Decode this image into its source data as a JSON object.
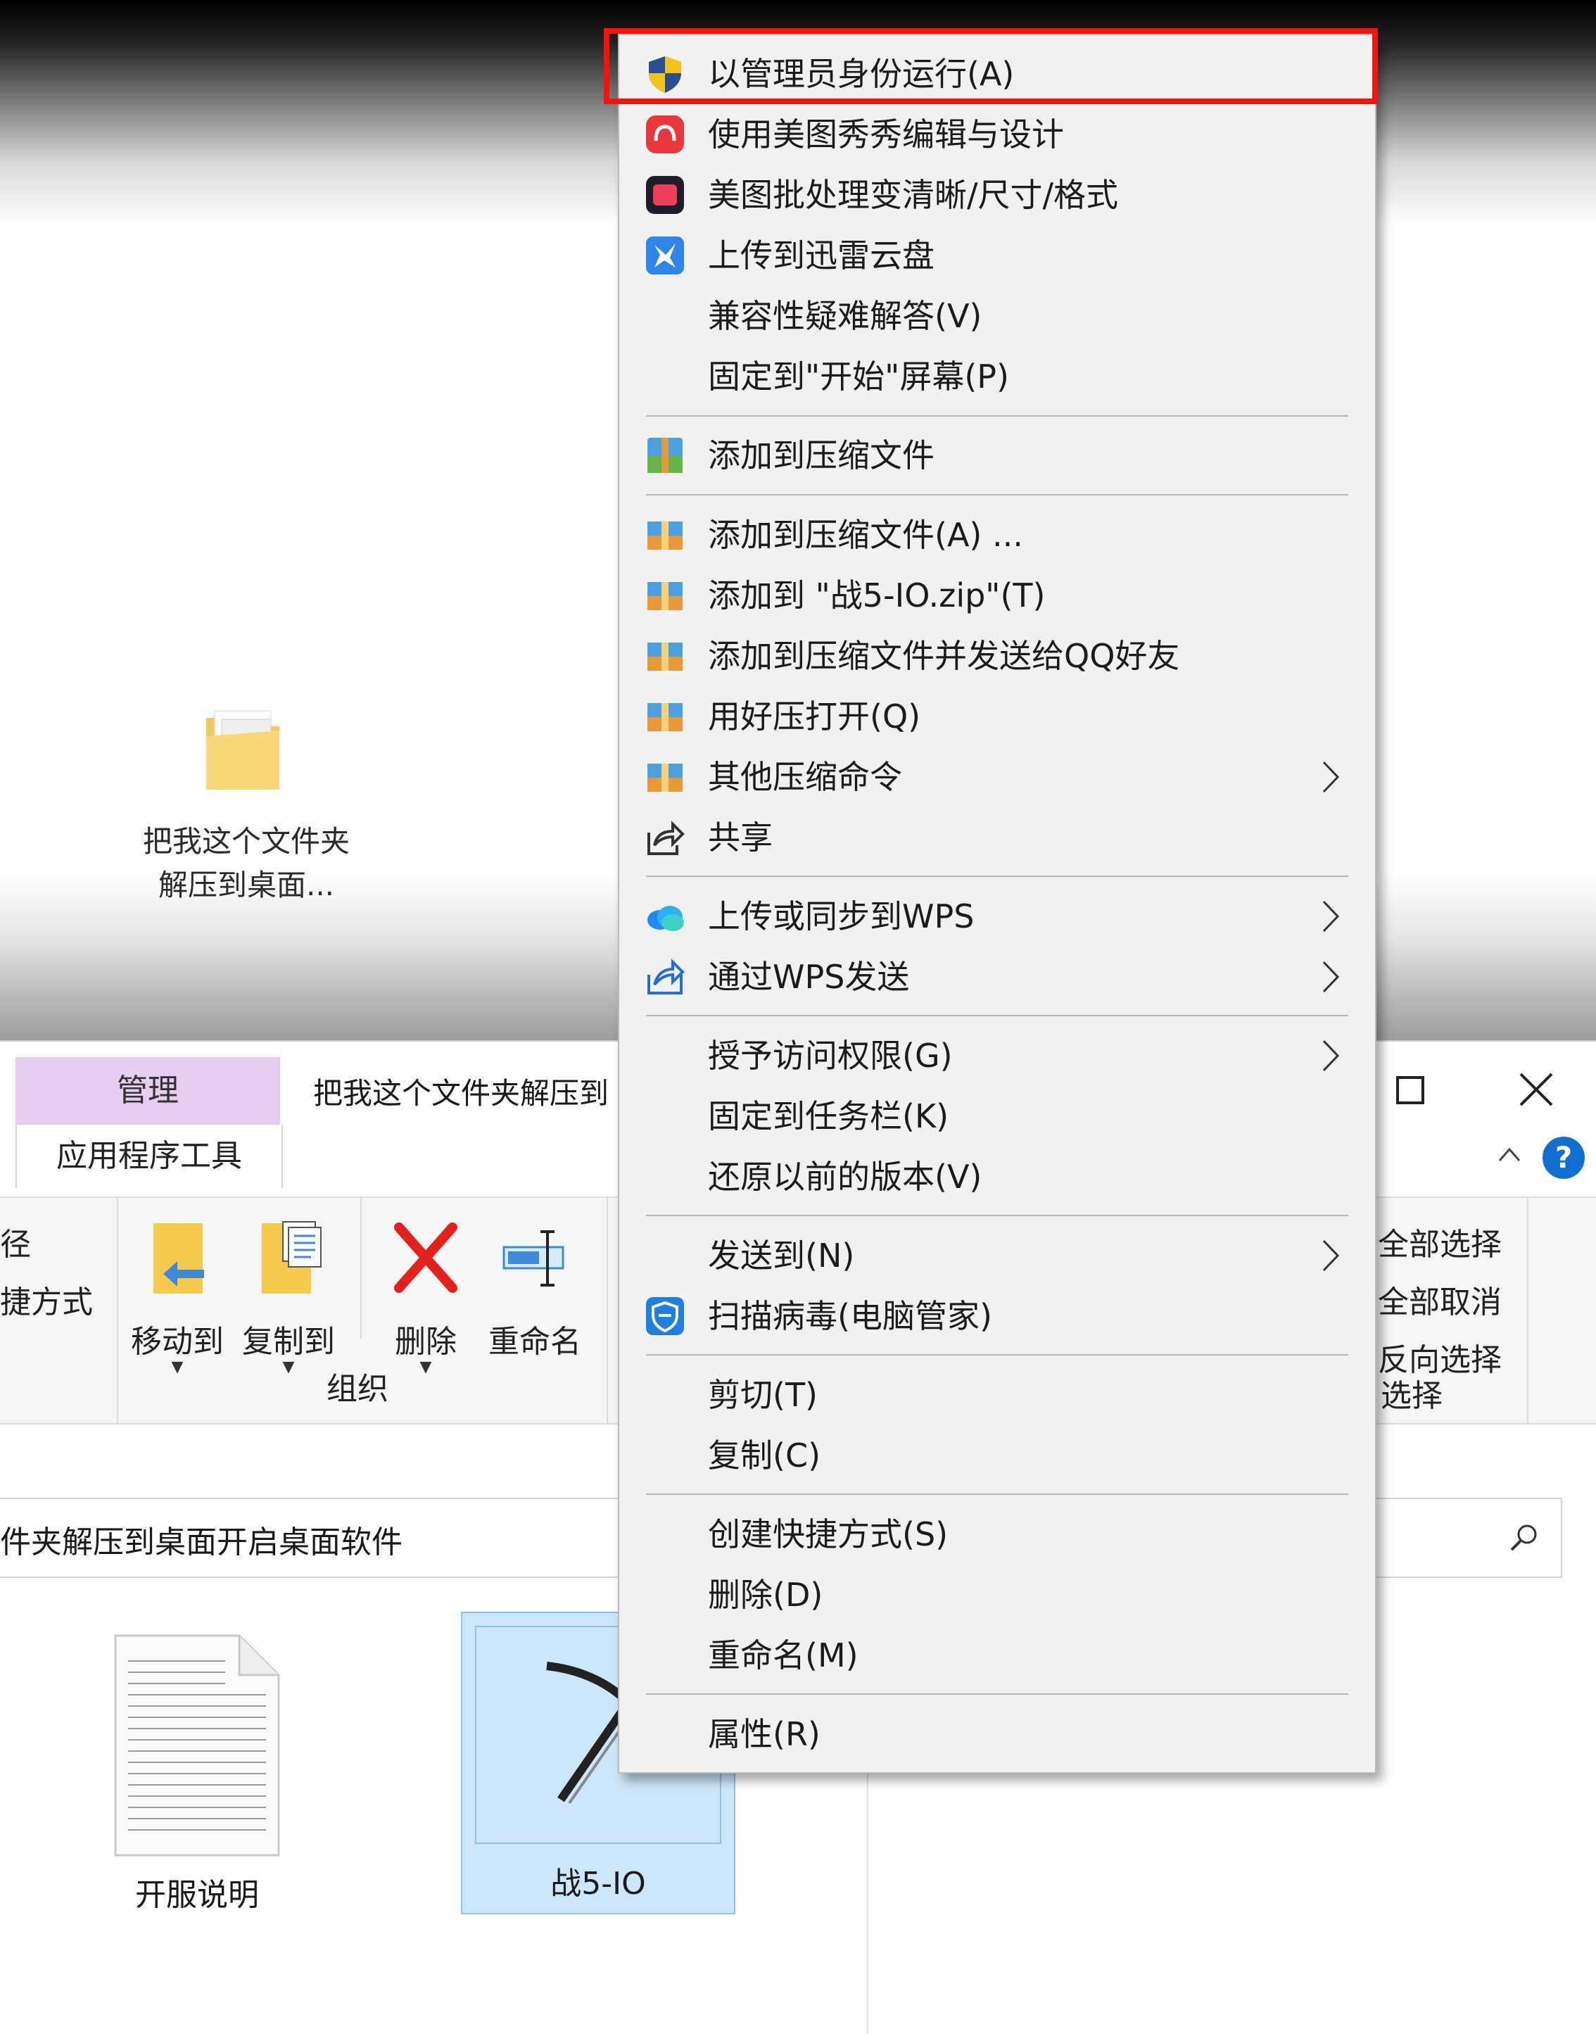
{
  "desktop": {
    "icon_label": "把我这个文件夹解压到桌面..."
  },
  "explorer": {
    "ribbon_tab_manage": "管理",
    "ribbon_tab_apptools": "应用程序工具",
    "window_title": "把我这个文件夹解压到",
    "ribbon_left_partial_1": "径",
    "ribbon_left_partial_2": "捷方式",
    "buttons": {
      "move_to": "移动到",
      "copy_to": "复制到",
      "delete": "删除",
      "rename": "重命名"
    },
    "group_organize": "组织",
    "select_all": "全部选择",
    "select_none": "全部取消",
    "invert_select": "反向选择",
    "group_select": "选择",
    "address": "件夹解压到桌面开启桌面软件",
    "files": [
      {
        "name": "开服说明"
      },
      {
        "name": "战5-IO"
      }
    ]
  },
  "context_menu": {
    "items": [
      {
        "label": "以管理员身份运行(A)",
        "icon": "uac-shield-icon"
      },
      {
        "label": "使用美图秀秀编辑与设计",
        "icon": "meitu-icon"
      },
      {
        "label": "美图批处理变清晰/尺寸/格式",
        "icon": "meitu-batch-icon"
      },
      {
        "label": "上传到迅雷云盘",
        "icon": "xunlei-icon"
      },
      {
        "label": "兼容性疑难解答(V)",
        "icon": ""
      },
      {
        "label": "固定到\"开始\"屏幕(P)",
        "icon": ""
      },
      {
        "label": "添加到压缩文件",
        "icon": "archive-icon"
      },
      {
        "label": "添加到压缩文件(A) ...",
        "icon": "archive-icon"
      },
      {
        "label": "添加到 \"战5-IO.zip\"(T)",
        "icon": "archive-icon"
      },
      {
        "label": "添加到压缩文件并发送给QQ好友",
        "icon": "archive-icon"
      },
      {
        "label": "用好压打开(Q)",
        "icon": "archive-icon"
      },
      {
        "label": "其他压缩命令",
        "icon": "archive-icon"
      },
      {
        "label": "共享",
        "icon": "share-icon"
      },
      {
        "label": "上传或同步到WPS",
        "icon": "wps-cloud-icon"
      },
      {
        "label": "通过WPS发送",
        "icon": "wps-send-icon"
      },
      {
        "label": "授予访问权限(G)",
        "icon": ""
      },
      {
        "label": "固定到任务栏(K)",
        "icon": ""
      },
      {
        "label": "还原以前的版本(V)",
        "icon": ""
      },
      {
        "label": "发送到(N)",
        "icon": ""
      },
      {
        "label": "扫描病毒(电脑管家)",
        "icon": "pc-manager-icon"
      },
      {
        "label": "剪切(T)",
        "icon": ""
      },
      {
        "label": "复制(C)",
        "icon": ""
      },
      {
        "label": "创建快捷方式(S)",
        "icon": ""
      },
      {
        "label": "删除(D)",
        "icon": ""
      },
      {
        "label": "重命名(M)",
        "icon": ""
      },
      {
        "label": "属性(R)",
        "icon": ""
      }
    ]
  },
  "colors": {
    "highlight_red": "#f2140d",
    "manage_tab": "#e6cdf2",
    "selection_blue": "#cce6fb",
    "help_blue": "#0f6fd1"
  }
}
